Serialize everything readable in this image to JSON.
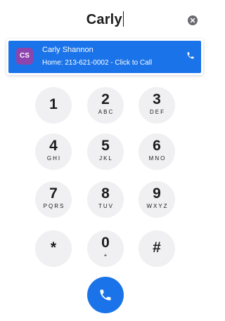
{
  "search": {
    "value": "Carly"
  },
  "suggestion": {
    "initials": "CS",
    "name": "Carly Shannon",
    "detail": "Home: 213-621-0002 - Click to Call",
    "avatar_color": "#8e44ad",
    "highlight_color": "#1a73e8"
  },
  "keypad": [
    {
      "digit": "1",
      "letters": ""
    },
    {
      "digit": "2",
      "letters": "ABC"
    },
    {
      "digit": "3",
      "letters": "DEF"
    },
    {
      "digit": "4",
      "letters": "GHI"
    },
    {
      "digit": "5",
      "letters": "JKL"
    },
    {
      "digit": "6",
      "letters": "MNO"
    },
    {
      "digit": "7",
      "letters": "PQRS"
    },
    {
      "digit": "8",
      "letters": "TUV"
    },
    {
      "digit": "9",
      "letters": "WXYZ"
    },
    {
      "digit": "*",
      "letters": ""
    },
    {
      "digit": "0",
      "letters": "+"
    },
    {
      "digit": "#",
      "letters": ""
    }
  ],
  "icons": {
    "clear": "close-circle-icon",
    "card_call": "phone-icon",
    "call": "phone-icon"
  },
  "colors": {
    "accent": "#1a73e8",
    "key_bg": "#f0f0f3",
    "text": "#1c1c1e"
  }
}
